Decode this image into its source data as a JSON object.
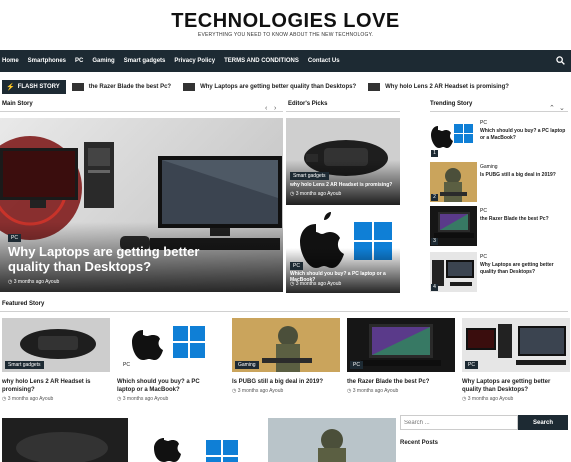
{
  "site": {
    "title": "TECHNOLOGIES LOVE",
    "tagline": "EVERYTHING YOU NEED TO KNOW ABOUT THE NEW TECHNOLOGY."
  },
  "nav": {
    "items": [
      "Home",
      "Smartphones",
      "PC",
      "Gaming",
      "Smart gadgets",
      "Privacy Policy",
      "TERMS AND CONDITIONS",
      "Contact Us"
    ],
    "search_icon": "search-icon"
  },
  "flash": {
    "label": "FLASH STORY",
    "items": [
      "the Razer Blade the best Pc?",
      "Why Laptops are getting better quality than Desktops?",
      "Why holo Lens 2 AR Headset is promising?"
    ]
  },
  "sections": {
    "main_story": "Main Story",
    "editors_picks": "Editor's Picks",
    "trending": "Trending Story",
    "featured": "Featured Story",
    "recent": "Recent Posts"
  },
  "main_story": {
    "category": "PC",
    "title": "Why Laptops are getting better quality than Desktops?",
    "meta": "3 months ago  Ayoub"
  },
  "editors_picks": [
    {
      "category": "Smart gadgets",
      "title": "why holo Lens 2 AR Headset is promising?",
      "meta": "3 months ago  Ayoub"
    },
    {
      "category": "PC",
      "title": "Which should you buy? a PC laptop or a MacBook?",
      "meta": "3 months ago  Ayoub"
    }
  ],
  "trending": [
    {
      "rank": "1",
      "category": "PC",
      "title": "Which should you buy? a PC laptop or a MacBook?"
    },
    {
      "rank": "2",
      "category": "Gaming",
      "title": "Is PUBG still a big deal in 2019?"
    },
    {
      "rank": "3",
      "category": "PC",
      "title": "the Razer Blade the best Pc?"
    },
    {
      "rank": "4",
      "category": "PC",
      "title": "Why Laptops are getting better quality than Desktops?"
    }
  ],
  "featured": [
    {
      "category": "Smart gadgets",
      "title": "why holo Lens 2 AR Headset is promising?",
      "meta": "3 months ago  Ayoub"
    },
    {
      "category": "PC",
      "title": "Which should you buy? a PC laptop or a MacBook?",
      "meta": "3 months ago  Ayoub"
    },
    {
      "category": "Gaming",
      "title": "Is PUBG still a big deal in 2019?",
      "meta": "3 months ago  Ayoub"
    },
    {
      "category": "PC",
      "title": "the Razer Blade the best Pc?",
      "meta": "3 months ago  Ayoub"
    },
    {
      "category": "PC",
      "title": "Why Laptops are getting better quality than Desktops?",
      "meta": "3 months ago  Ayoub"
    }
  ],
  "search": {
    "placeholder": "Search ...",
    "button": "Search"
  },
  "colors": {
    "nav_bg": "#1d2a33",
    "accent_yellow": "#f7c600",
    "microsoft_blue": "#0f7fd6"
  }
}
